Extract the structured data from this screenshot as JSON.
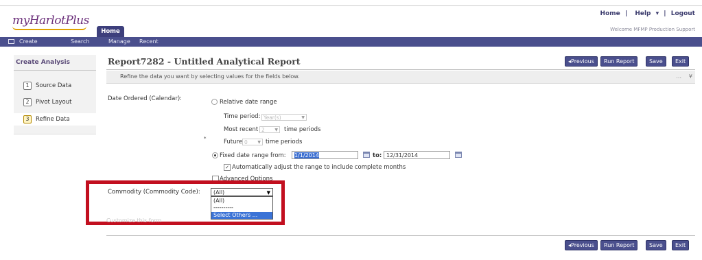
{
  "app": {
    "logo_text": "myHarlotPlus",
    "home_tab": "Home"
  },
  "top_links": {
    "home": "Home",
    "sep1": "|",
    "help": "Help",
    "help_arrow": "▾",
    "sep2": "|",
    "logout": "Logout"
  },
  "welcome": "Welcome MFMP Production Support",
  "nav": {
    "create": "Create",
    "search": "Search",
    "manage": "Manage",
    "recent": "Recent"
  },
  "left_panel": {
    "title": "Create Analysis",
    "steps": [
      {
        "num": "1",
        "label": "Source Data"
      },
      {
        "num": "2",
        "label": "Pivot Layout"
      },
      {
        "num": "3",
        "label": "Refine Data"
      }
    ]
  },
  "report": {
    "title": "Report7282 - Untitled Analytical Report"
  },
  "buttons": {
    "previous": "◂Previous",
    "run": "Run Report",
    "save": "Save",
    "exit": "Exit"
  },
  "refine_bar": {
    "text": "Refine the data you want by selecting values for the fields below.",
    "dots": "...",
    "gear": "¥"
  },
  "date_filter": {
    "label": "Date Ordered (Calendar):",
    "relative_label": "Relative date range",
    "time_period_label": "Time period:",
    "time_period_value": "Year(s)",
    "most_recent_label": "Most recent",
    "most_recent_value": "2",
    "periods_suffix": "time periods",
    "future_label": "Future",
    "future_value": "0",
    "fixed_label": "Fixed date range from:",
    "from_value": "1/1/2014",
    "to_label": "to:",
    "to_value": "12/31/2014",
    "auto_adjust_label": "Automatically adjust the range to include complete months",
    "star": "*"
  },
  "advanced_options": "Advanced Options",
  "commodity": {
    "label": "Commodity (Commodity Code):",
    "selected": "(All)",
    "options": [
      "(All)",
      "----------",
      "Select Others ..."
    ]
  },
  "faint_link": "Customize this form"
}
